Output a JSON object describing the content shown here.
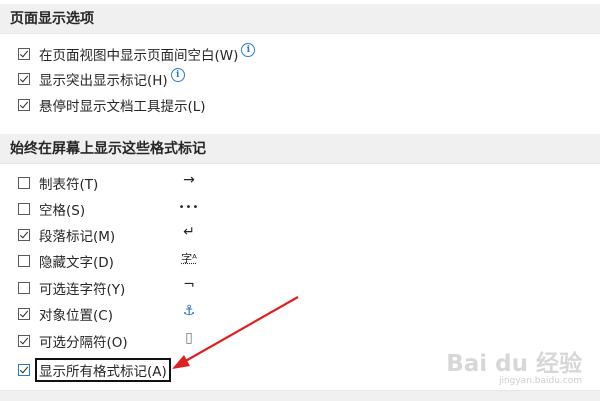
{
  "section1": {
    "title": "页面显示选项",
    "options": [
      {
        "label": "在页面视图中显示页面间空白(W)",
        "checked": true,
        "info": true
      },
      {
        "label": "显示突出显示标记(H)",
        "checked": true,
        "info": true
      },
      {
        "label": "悬停时显示文档工具提示(L)",
        "checked": true,
        "info": false
      }
    ]
  },
  "section2": {
    "title": "始终在屏幕上显示这些格式标记",
    "marks": [
      {
        "label": "制表符(T)",
        "checked": false,
        "symbol": "→"
      },
      {
        "label": "空格(S)",
        "checked": false,
        "symbol": "•••"
      },
      {
        "label": "段落标记(M)",
        "checked": true,
        "symbol": "↵"
      },
      {
        "label": "隐藏文字(D)",
        "checked": false,
        "symbol": "字ᴬ"
      },
      {
        "label": "可选连字符(Y)",
        "checked": false,
        "symbol": "¬"
      },
      {
        "label": "对象位置(C)",
        "checked": true,
        "symbol": "⚓"
      },
      {
        "label": "可选分隔符(O)",
        "checked": true,
        "symbol": "▯"
      },
      {
        "label": "显示所有格式标记(A)",
        "checked": true,
        "symbol": ""
      }
    ]
  },
  "info_glyph": "i",
  "watermark": {
    "main": "Bai du 经验",
    "sub": "jingyan.baidu.com"
  },
  "colors": {
    "header_bg": "#f0f0f0",
    "info_blue": "#2b79d6",
    "arrow_red": "#e02020",
    "anchor_blue": "#1f6fc5"
  }
}
